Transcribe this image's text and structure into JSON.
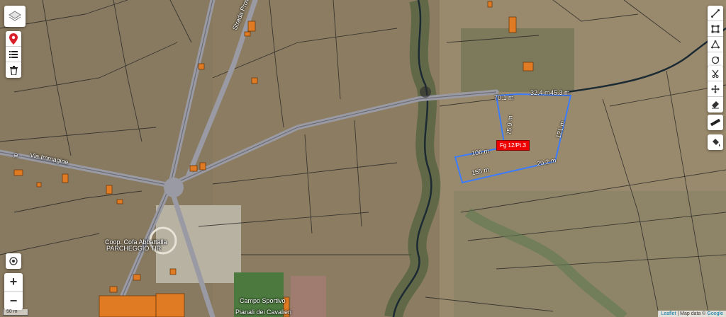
{
  "labels": {
    "parcel": "Fg 12/Pt.3",
    "road_via": "Via Immagine",
    "road_sp": "Strada Provinciale ... per",
    "place_cooperative": "Coop. Cofa Abbattalla",
    "place_parking": "PARCHEGGIO TIR",
    "place_sport": "Campo Sportivo",
    "place_sport2": "Pianali dei Cavalieri"
  },
  "measurements": {
    "m1": "70.1 m",
    "m2": "32.4 m",
    "m3": "45.3 m",
    "m4": "121 m",
    "m5": "29.2 m",
    "m6": "155 m",
    "m7": "106 m",
    "m8": "75.9 m"
  },
  "scale": "50 m",
  "attribution": {
    "leaflet": "Leaflet",
    "sep": " | Map data © ",
    "google": "Google"
  },
  "colors": {
    "parcel_outline": "#3b7cff",
    "parcel_tag": "#e00000",
    "marker": "#d9202a",
    "road": "#9a9aa4",
    "stream": "#1b2a33",
    "building": "#e07b23"
  },
  "icons": {
    "layers": "layers-icon",
    "marker": "map-marker-icon",
    "list": "list-icon",
    "trash": "trash-icon",
    "locate": "locate-icon",
    "zoom_in": "plus-icon",
    "zoom_out": "minus-icon",
    "draw_line": "draw-polyline-icon",
    "draw_rect": "draw-rectangle-icon",
    "draw_poly": "draw-polygon-icon",
    "draw_circle": "draw-circle-icon",
    "cut": "cut-icon",
    "move": "move-icon",
    "erase": "eraser-icon",
    "ruler": "ruler-icon",
    "fill": "paint-bucket-icon"
  },
  "zoom": {
    "in": "+",
    "out": "−"
  }
}
